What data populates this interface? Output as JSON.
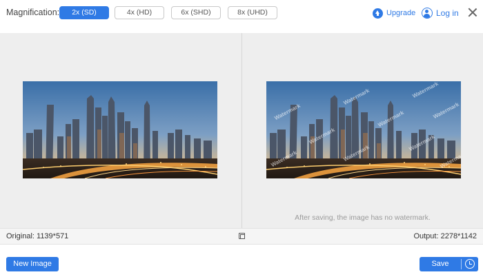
{
  "header": {
    "magnification_label": "Magnification:",
    "options": [
      "2x (SD)",
      "4x (HD)",
      "6x (SHD)",
      "8x (UHD)"
    ],
    "selected": "2x (SD)",
    "upgrade_label": "Upgrade",
    "login_label": "Log in"
  },
  "preview": {
    "watermark_text": "Watermark",
    "note": "After saving, the image has no watermark."
  },
  "info": {
    "original": "Original: 1139*571",
    "output": "Output: 2278*1142"
  },
  "footer": {
    "new_image_label": "New Image",
    "save_label": "Save"
  },
  "icons": {
    "upgrade": "upload-arrow-icon",
    "login": "user-icon",
    "close": "close-icon",
    "compare": "compare-icon",
    "history": "clock-icon"
  },
  "colors": {
    "accent": "#2f7ae5",
    "panel_background": "#eeeeee",
    "note_text": "#9a9a9a"
  }
}
